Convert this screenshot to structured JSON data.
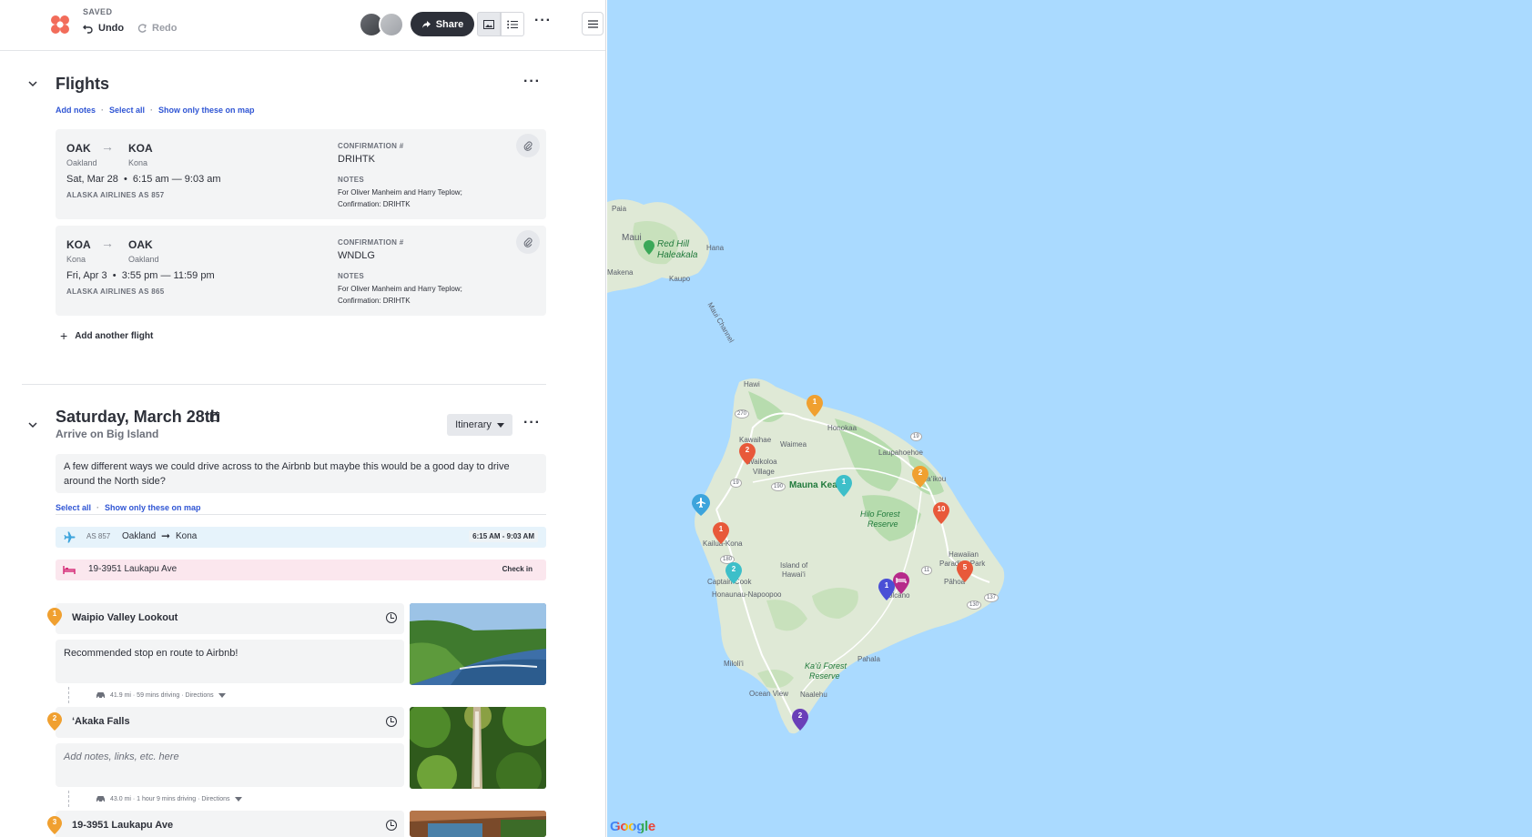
{
  "topbar": {
    "status": "SAVED",
    "undo_label": "Undo",
    "redo_label": "Redo",
    "share_label": "Share"
  },
  "flights_section": {
    "title": "Flights",
    "links": [
      "Add notes",
      "Select all",
      "Show only these on map"
    ],
    "separator": "·",
    "add_flight_label": "Add another flight",
    "flights": [
      {
        "from_code": "OAK",
        "from_city": "Oakland",
        "to_code": "KOA",
        "to_city": "Kona",
        "time": "Sat, Mar 28  •  6:15 am — 9:03 am",
        "airline": "ALASKA AIRLINES AS 857",
        "conf_label": "CONFIRMATION #",
        "conf": "DRIHTK",
        "notes_label": "NOTES",
        "notes_line1": "For Oliver Manheim and Harry Teplow;",
        "notes_line2": "Confirmation: DRIHTK"
      },
      {
        "from_code": "KOA",
        "from_city": "Kona",
        "to_code": "OAK",
        "to_city": "Oakland",
        "time": "Fri, Apr 3  •  3:55 pm — 11:59 pm",
        "airline": "ALASKA AIRLINES AS 865",
        "conf_label": "CONFIRMATION #",
        "conf": "WNDLG",
        "notes_label": "NOTES",
        "notes_line1": "For Oliver Manheim and Harry Teplow;",
        "notes_line2": "Confirmation: DRIHTK"
      }
    ]
  },
  "day": {
    "title": "Saturday, March 28th",
    "subtitle": "Arrive on Big Island",
    "view_label": "Itinerary",
    "note": "A few different ways we could drive across to the Airbnb but maybe this would be a good day to drive around the North side?",
    "links": [
      "Select all",
      "Show only these on map"
    ],
    "flight_row": {
      "flight_no": "AS 857",
      "from": "Oakland",
      "to": "Kona",
      "time": "6:15 AM - 9:03 AM"
    },
    "hotel_row": {
      "name": "19-3951 Laukapu Ave",
      "action": "Check in"
    },
    "places": [
      {
        "num": "1",
        "name": "Waipio Valley Lookout",
        "note": "Recommended stop en route to Airbnb!",
        "travel": "41.9 mi · 59 mins driving · ",
        "directions": "Directions"
      },
      {
        "num": "2",
        "name": "‘Akaka Falls",
        "note": "Add notes, links, etc. here",
        "travel": "43.0 mi · 1 hour 9 mins driving · ",
        "directions": "Directions"
      },
      {
        "num": "3",
        "name": "19-3951 Laukapu Ave"
      }
    ]
  },
  "map": {
    "labels": {
      "paia": "Paia",
      "maui": "Maui",
      "red_hill": "Red Hill",
      "haleakala": "Haleakala",
      "hana": "Hana",
      "makena": "Makena",
      "kaupo": "Kaupo",
      "channel": "Maui Channel",
      "hawi": "Hawi",
      "honokaa": "Honokaa",
      "kawaihae": "Kawaihae",
      "waimea": "Waimea",
      "laupahoehoe": "Laupahoehoe",
      "waikoloa": "Waikoloa",
      "village": "Village",
      "mauna_kea": "Mauna Kea",
      "hilo_forest": "Hilo Forest",
      "reserve": "Reserve",
      "papaikou": "Pāpa‘ikou",
      "kailua_kona": "Kailua-Kona",
      "island_of": "Island of",
      "hawaii": "Hawai‘i",
      "captain_cook": "Captain Cook",
      "honaunau": "Honaunau-Napoopoo",
      "volcano": "Volcano",
      "hawaiian": "Hawaiian",
      "paradise_park": "Paradise Park",
      "pahoa": "Pāhoa",
      "milolii": "Miloli‘i",
      "kau_forest": "Ka‘ū Forest",
      "pahala": "Pahala",
      "ocean_view": "Ocean View",
      "naalehu": "Naalehu",
      "google": "Google"
    },
    "route_shields": [
      "270",
      "19",
      "190",
      "19",
      "11",
      "180",
      "11",
      "130",
      "137"
    ],
    "pins": [
      {
        "num": "1",
        "color": "#f0a030"
      },
      {
        "num": "2",
        "color": "#e8593a"
      },
      {
        "num": "1",
        "color": "#3dbfc9"
      },
      {
        "num": "2",
        "color": "#f0a030"
      },
      {
        "num": "10",
        "color": "#e8593a"
      },
      {
        "num": "1",
        "color": "#e8593a"
      },
      {
        "num": "2",
        "color": "#3dbfc9"
      },
      {
        "num": "5",
        "color": "#e8593a"
      },
      {
        "num": "1",
        "color": "#4a4fd6"
      },
      {
        "num": "2",
        "color": "#6a3fb8"
      }
    ],
    "colors": {
      "water": "#aadaff",
      "land": "#dfe9d6",
      "forest": "#b7dcae",
      "accent": "#2f55d4"
    }
  }
}
